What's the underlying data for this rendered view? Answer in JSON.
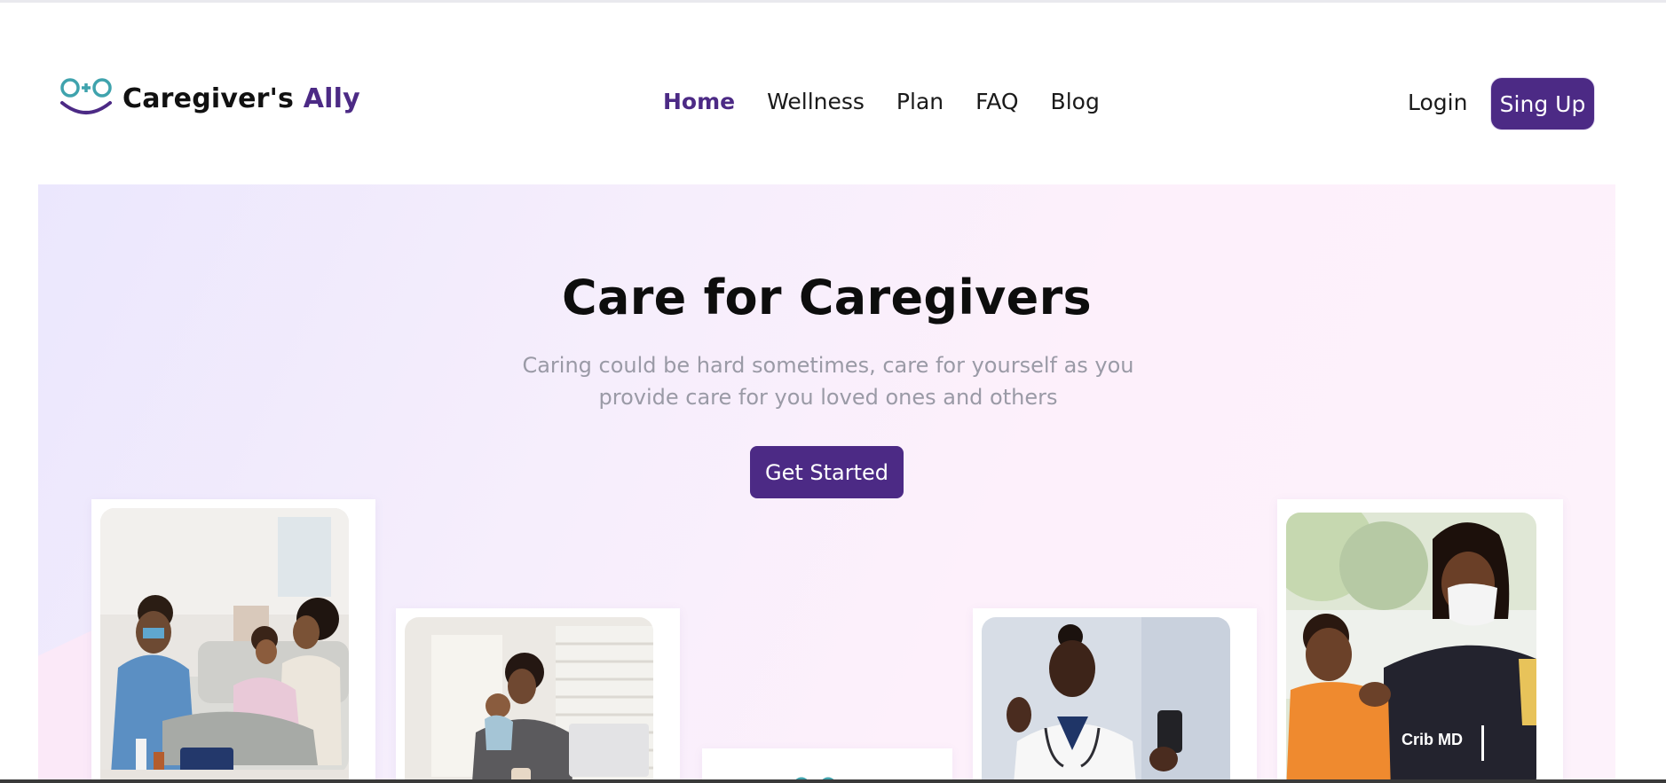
{
  "brand": {
    "name_primary": "Caregiver's",
    "name_accent": "Ally",
    "logo_icon": "caregivers-ally-logo-icon",
    "accent_color": "#4c2a85",
    "logo_teal": "#3fa3ad"
  },
  "nav": {
    "items": [
      {
        "label": "Home",
        "active": true
      },
      {
        "label": "Wellness",
        "active": false
      },
      {
        "label": "Plan",
        "active": false
      },
      {
        "label": "FAQ",
        "active": false
      },
      {
        "label": "Blog",
        "active": false
      }
    ]
  },
  "auth": {
    "login_label": "Login",
    "signup_label": "Sing Up"
  },
  "hero": {
    "title": "Care for Caregivers",
    "subtitle": "Caring could be hard sometimes, care for yourself as you provide care for you loved ones and others",
    "cta_label": "Get Started",
    "background_start": "#ebe7fd",
    "background_end": "#fdf2fb"
  },
  "gallery": {
    "photos": [
      {
        "icon": "nurse-visiting-family-photo"
      },
      {
        "icon": "mother-with-baby-at-laptop-photo"
      },
      {
        "icon": "brand-logo-card"
      },
      {
        "icon": "doctor-waving-at-phone-photo"
      },
      {
        "icon": "mother-and-child-photo"
      }
    ],
    "shirt_text": "Crib MD"
  }
}
